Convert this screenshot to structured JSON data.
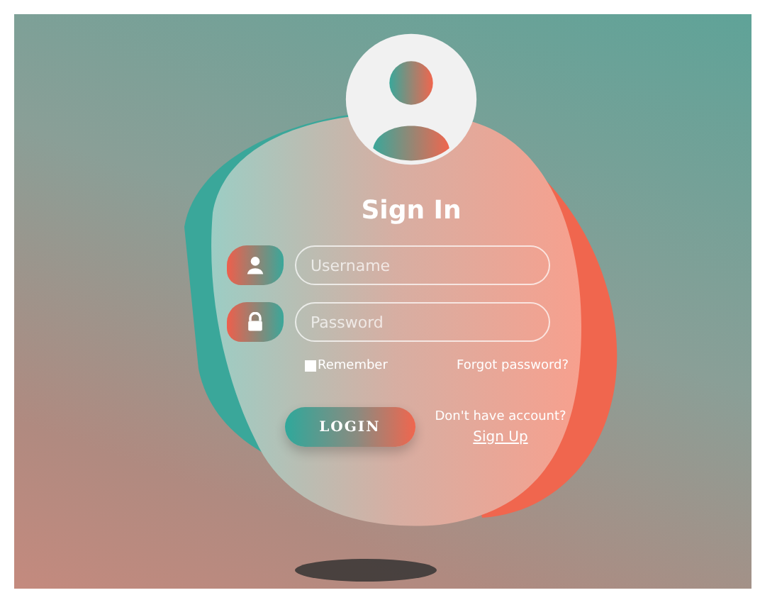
{
  "title": "Sign In",
  "fields": [
    {
      "kind": "user",
      "placeholder": "Username"
    },
    {
      "kind": "password",
      "placeholder": "Password"
    }
  ],
  "remember": {
    "label": "Remember",
    "checked": false
  },
  "forgot_link": "Forgot password?",
  "login_button": "LOGIN",
  "signup_prompt": "Don't have account?",
  "signup_link": "Sign Up"
}
